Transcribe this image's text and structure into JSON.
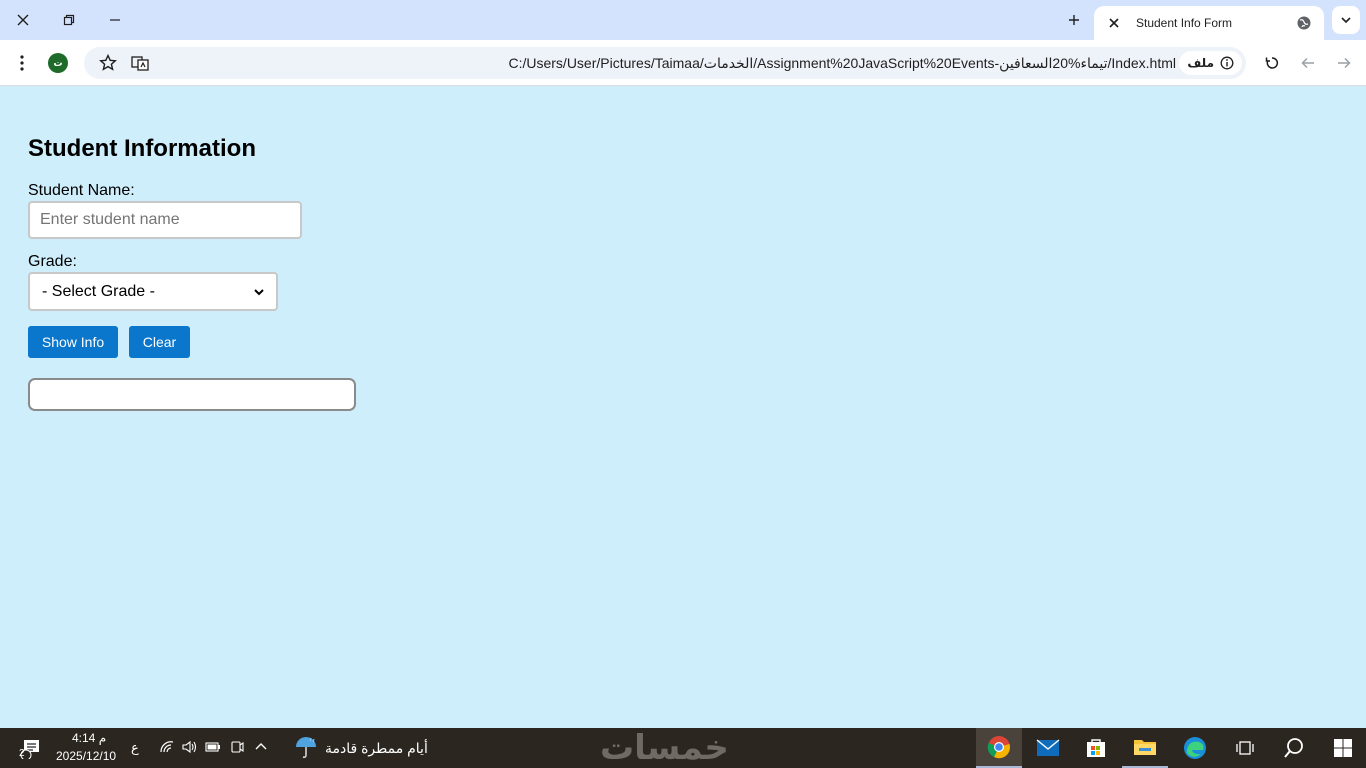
{
  "browser": {
    "tab_title": "Student Info Form",
    "url": "C:/Users/User/Pictures/Taimaa/الخدمات/Assignment%20JavaScript%20Events-تيماء%20السعافين/Index.html",
    "site_chip_label": "ملف",
    "profile_initial": "ت"
  },
  "page": {
    "heading": "Student Information",
    "student_name_label": "Student Name:",
    "student_name_placeholder": "Enter student name",
    "grade_label": "Grade:",
    "grade_selected": "- Select Grade -",
    "show_info_label": "Show Info",
    "clear_label": "Clear",
    "result_text": ""
  },
  "taskbar": {
    "time": "4:14 م",
    "date": "2025/12/10",
    "lang": "ع",
    "notification_count": "2",
    "weather": "أيام ممطرة قادمة",
    "watermark": "خمسات"
  },
  "colors": {
    "page_background": "#cfeefb",
    "button_blue": "#0a76cc",
    "titlebar": "#d3e3fd",
    "taskbar": "#2b2620"
  }
}
